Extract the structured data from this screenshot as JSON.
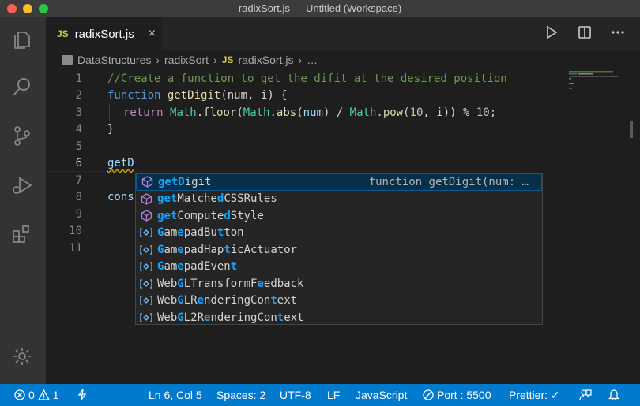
{
  "window": {
    "title": "radixSort.js — Untitled (Workspace)"
  },
  "tab": {
    "badge": "JS",
    "title": "radixSort.js",
    "close": "×"
  },
  "breadcrumb": {
    "folder": "DataStructures",
    "sub": "radixSort",
    "badge": "JS",
    "file": "radixSort.js",
    "tail": "…",
    "sep": "›"
  },
  "editor": {
    "line_numbers": [
      "1",
      "2",
      "3",
      "4",
      "5",
      "6",
      "7",
      "8",
      "9",
      "10",
      "11"
    ],
    "l1": "//Create a function to get the difit at the desired position",
    "l2": {
      "kw": "function",
      "fn": "getDigit",
      "rest": "(num, i) {"
    },
    "l3": {
      "kw": "return",
      "cls1": "Math",
      "fn1": "floor",
      "cls2": "Math",
      "fn2": "abs",
      "arg1": "num",
      "cls3": "Math",
      "fn3": "pow",
      "n1": "10",
      "arg2": "i",
      "n2": "10"
    },
    "l4": "}",
    "l6": "getD",
    "l8": "cons"
  },
  "suggest": {
    "items": [
      {
        "pre": "getD",
        "mid": "igit",
        "detail": "function getDigit(num: …",
        "kind": "method"
      },
      {
        "label": "getMatchedCSSRules",
        "kind": "method"
      },
      {
        "label": "getComputedStyle",
        "kind": "method"
      },
      {
        "label": "GamepadButton",
        "kind": "class"
      },
      {
        "label": "GamepadHapticActuator",
        "kind": "class"
      },
      {
        "label": "GamepadEvent",
        "kind": "class"
      },
      {
        "label": "WebGLTransformFeedback",
        "kind": "class"
      },
      {
        "label": "WebGLRenderingContext",
        "kind": "class"
      },
      {
        "label": "WebGL2RenderingContext",
        "kind": "class"
      }
    ]
  },
  "status": {
    "errors": "0",
    "warnings": "1",
    "position": "Ln 6, Col 5",
    "spaces": "Spaces: 2",
    "encoding": "UTF-8",
    "eol": "LF",
    "language": "JavaScript",
    "port": "Port : 5500",
    "prettier": "Prettier: ✓"
  },
  "colors": {
    "statusbar": "#007acc",
    "accent_match": "#18a3ff",
    "method_icon": "#b180d7",
    "class_icon": "#75beff"
  },
  "icons": [
    "files-icon",
    "search-icon",
    "source-control-icon",
    "run-debug-icon",
    "extensions-icon",
    "settings-gear-icon",
    "run-icon",
    "split-editor-icon",
    "more-icon",
    "feedback-icon",
    "bell-icon",
    "sync-icon"
  ]
}
